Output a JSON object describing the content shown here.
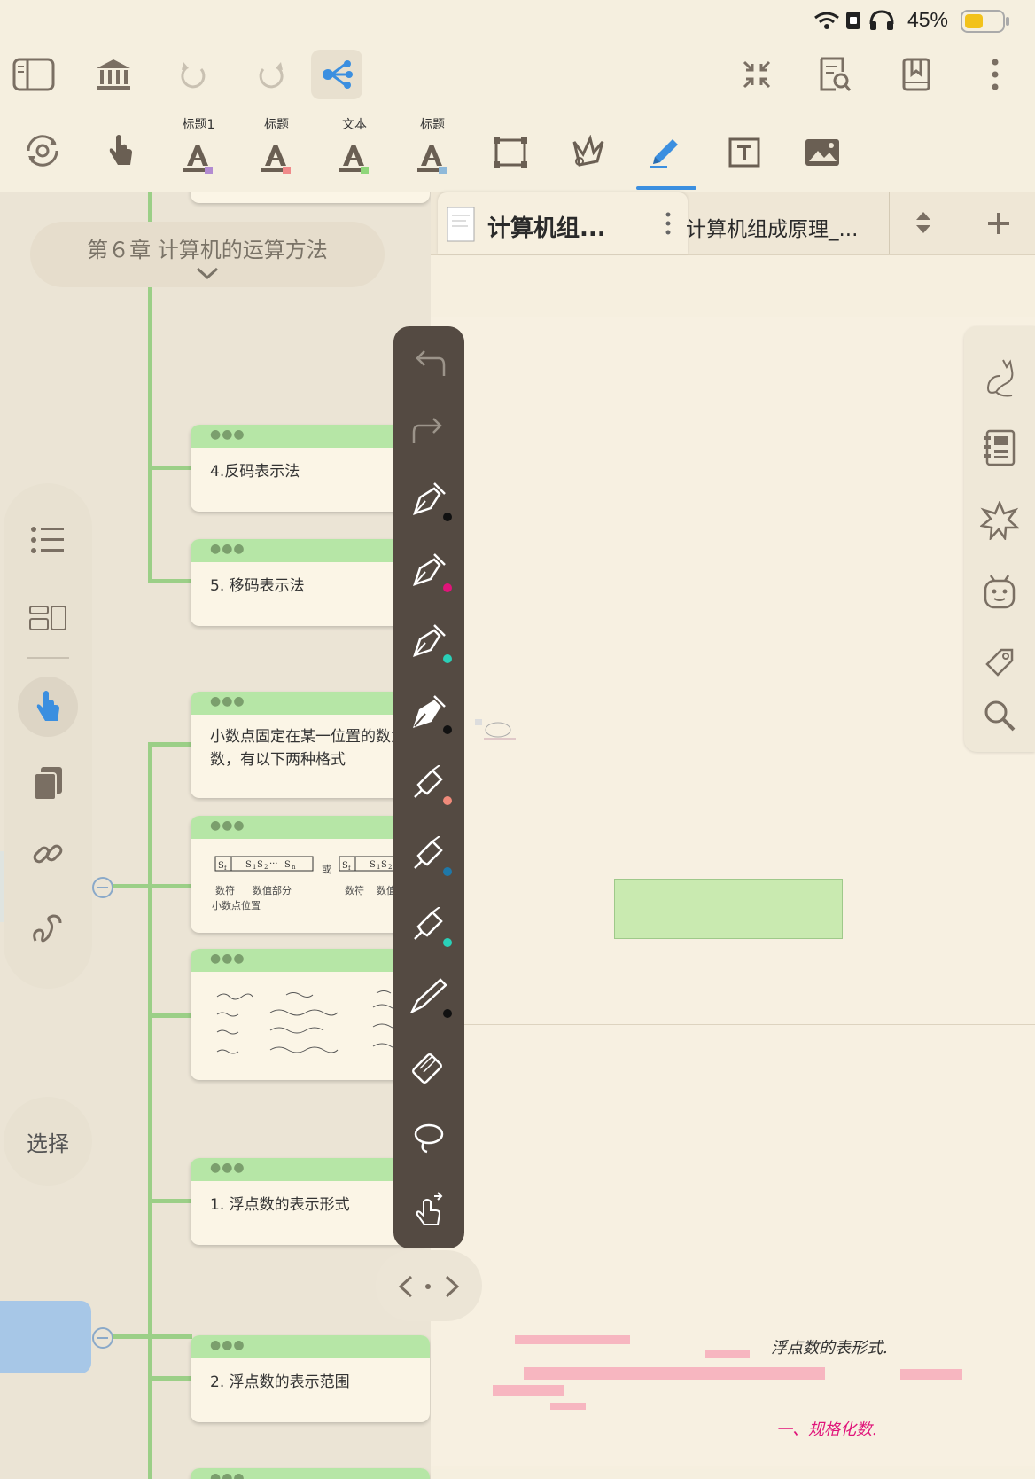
{
  "status": {
    "battery": "45%"
  },
  "toolbar": {
    "style_labels": [
      "标题1",
      "标题",
      "文本",
      "标题"
    ],
    "style_colors": [
      "#b28bd1",
      "#f08a8a",
      "#8fd67a",
      "#8fb9d9"
    ],
    "accent": "#3b8fe0"
  },
  "mindmap": {
    "chapter": "第６章 计算机的运算方法",
    "nodes": [
      {
        "text": "4.反码表示法"
      },
      {
        "text": "5.  移码表示法"
      },
      {
        "text": "小数点固定在某一位置的数为定\n数，有以下两种格式"
      },
      {
        "text": "1.  浮点数的表示形式"
      },
      {
        "text": "2. 浮点数的表示范围"
      }
    ],
    "formula_labels": [
      "数符",
      "数值部分",
      "小数点位置",
      "或",
      "数符",
      "数值部分"
    ],
    "select_label": "选择"
  },
  "document": {
    "tab_active": "计算机组...",
    "tab_second": "计算机组成原理_...",
    "handwriting": [
      "浮点数的表形式.",
      "一、规格化数."
    ]
  },
  "icons": {
    "top": [
      "sidebar-icon",
      "library-icon",
      "undo-icon",
      "redo-icon",
      "mindmap-icon",
      "collapse-icon",
      "doc-search-icon",
      "bookmark-icon",
      "more-icon"
    ],
    "pen_colors": [
      "#111111",
      "#e0147a",
      "#2ad0b8",
      "#111111",
      "#f08a7a",
      "#1f78a8",
      "#2ad0b8",
      "#111111"
    ]
  }
}
